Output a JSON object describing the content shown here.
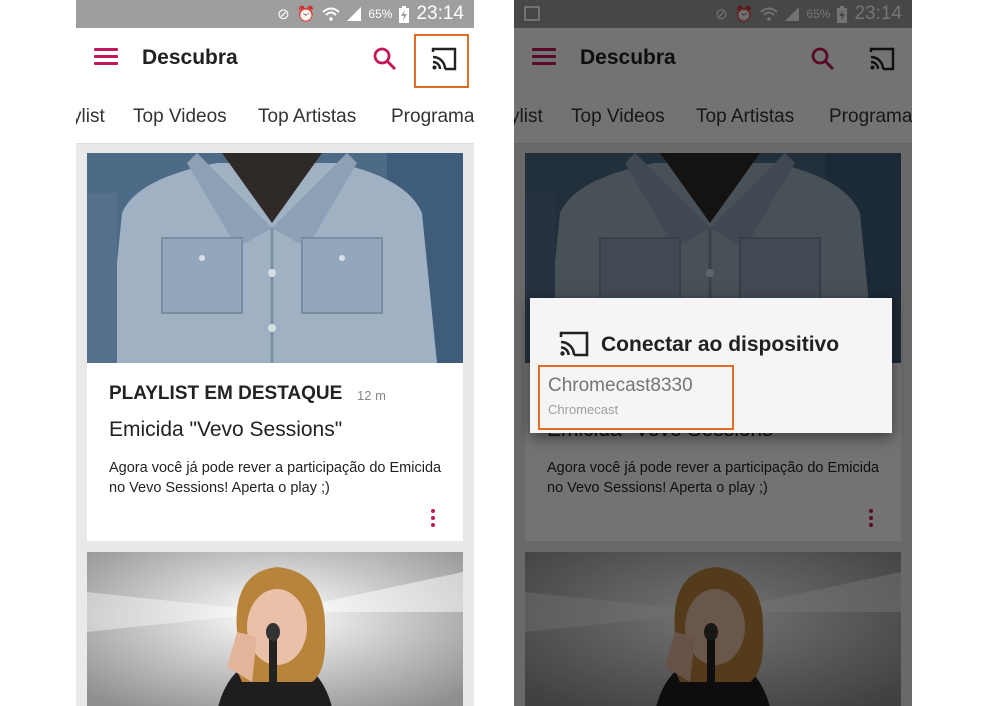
{
  "colors": {
    "accent": "#c2185b",
    "highlight": "#e46b23",
    "status_bar": "#9e9e9e"
  },
  "status_bar": {
    "battery": "65%",
    "time": "23:14",
    "icons": [
      "mute-vibrate-icon",
      "alarm-icon",
      "wifi-icon",
      "signal-icon",
      "battery-charging-icon"
    ]
  },
  "app_bar": {
    "menu_icon": "menu-icon",
    "title": "Descubra",
    "search_icon": "search-icon",
    "cast_icon": "cast-icon"
  },
  "tabs": [
    "ylist",
    "Top Videos",
    "Top Artistas",
    "Programa"
  ],
  "card_featured": {
    "kicker": "PLAYLIST EM DESTAQUE",
    "time": "12 m",
    "title": "Emicida \"Vevo Sessions\"",
    "description": "Agora você já pode rever a participação do Emicida no Vevo Sessions! Aperta o play ;)",
    "image": "man-in-denim-shirt-photo",
    "more_icon": "more-vertical-icon"
  },
  "card_next": {
    "image": "singer-with-microphone-photo"
  },
  "cast_dialog": {
    "title": "Conectar ao dispositivo",
    "device_name": "Chromecast8330",
    "device_type": "Chromecast"
  }
}
